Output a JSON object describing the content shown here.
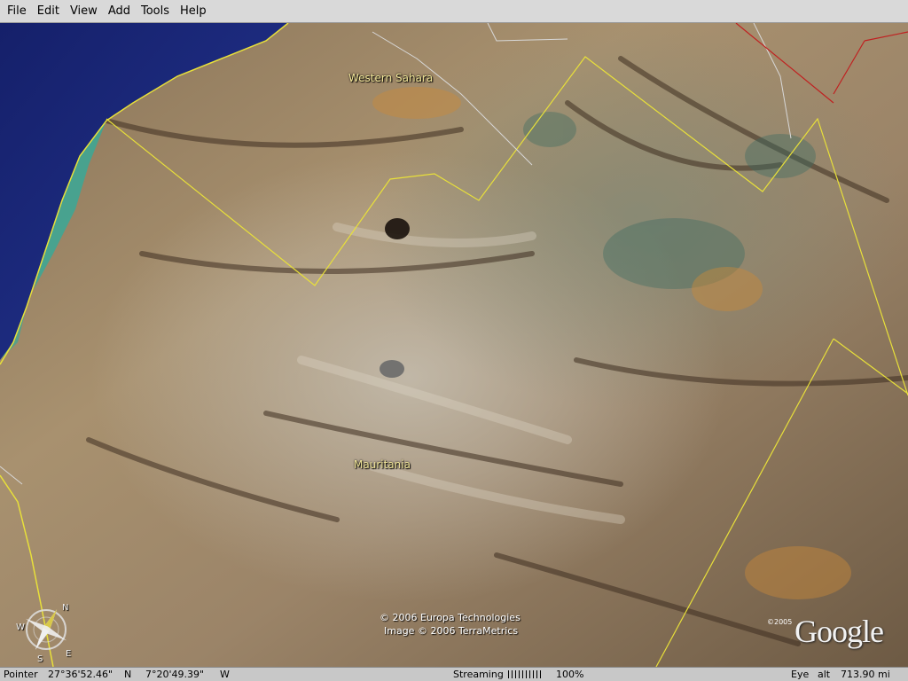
{
  "menubar": {
    "items": [
      "File",
      "Edit",
      "View",
      "Add",
      "Tools",
      "Help"
    ]
  },
  "map": {
    "labels": {
      "western_sahara": "Western Sahara",
      "mauritania": "Mauritania"
    },
    "copyright_line1": "© 2006 Europa Technologies",
    "copyright_line2": "Image © 2006 TerraMetrics",
    "google_year": "©2005",
    "google_logo": "Google",
    "compass": {
      "n": "N",
      "e": "E",
      "s": "S",
      "w": "W"
    }
  },
  "statusbar": {
    "pointer_label": "Pointer",
    "latitude": "27°36'52.46\"",
    "lat_hemisphere": "N",
    "longitude": "7°20'49.39\"",
    "lon_hemisphere": "W",
    "streaming_label": "Streaming",
    "streaming_percent": "100%",
    "eye_label": "Eye",
    "alt_label": "alt",
    "altitude": "713.90 mi"
  },
  "colors": {
    "ocean": "#1c2b7a",
    "coast_shallow": "#3aa896",
    "border_line": "#e8e03a",
    "road_line": "#d8d8d8",
    "red_border": "#c02020"
  }
}
